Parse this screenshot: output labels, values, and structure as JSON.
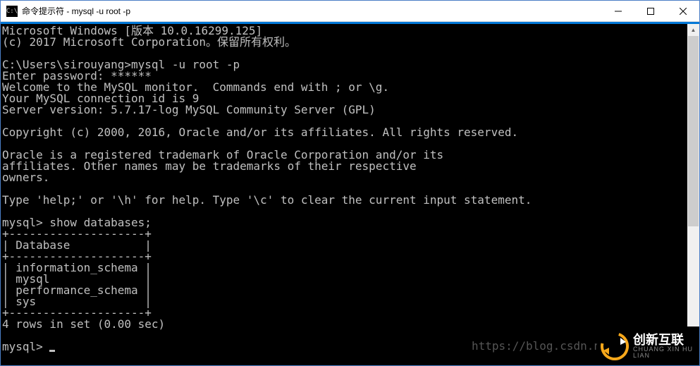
{
  "titlebar": {
    "icon_text": "C:\\",
    "title": "命令提示符 - mysql  -u root -p"
  },
  "terminal": {
    "lines": [
      "Microsoft Windows [版本 10.0.16299.125]",
      "(c) 2017 Microsoft Corporation。保留所有权利。",
      "",
      "C:\\Users\\sirouyang>mysql -u root -p",
      "Enter password: ******",
      "Welcome to the MySQL monitor.  Commands end with ; or \\g.",
      "Your MySQL connection id is 9",
      "Server version: 5.7.17-log MySQL Community Server (GPL)",
      "",
      "Copyright (c) 2000, 2016, Oracle and/or its affiliates. All rights reserved.",
      "",
      "Oracle is a registered trademark of Oracle Corporation and/or its",
      "affiliates. Other names may be trademarks of their respective",
      "owners.",
      "",
      "Type 'help;' or '\\h' for help. Type '\\c' to clear the current input statement.",
      "",
      "mysql> show databases;",
      "+--------------------+",
      "| Database           |",
      "+--------------------+",
      "| information_schema |",
      "| mysql              |",
      "| performance_schema |",
      "| sys                |",
      "+--------------------+",
      "4 rows in set (0.00 sec)",
      "",
      "mysql> "
    ]
  },
  "watermark": "https://blog.csdn.n",
  "logo": {
    "main": "创新互联",
    "sub": "CHUANG XIN HU LIAN"
  }
}
